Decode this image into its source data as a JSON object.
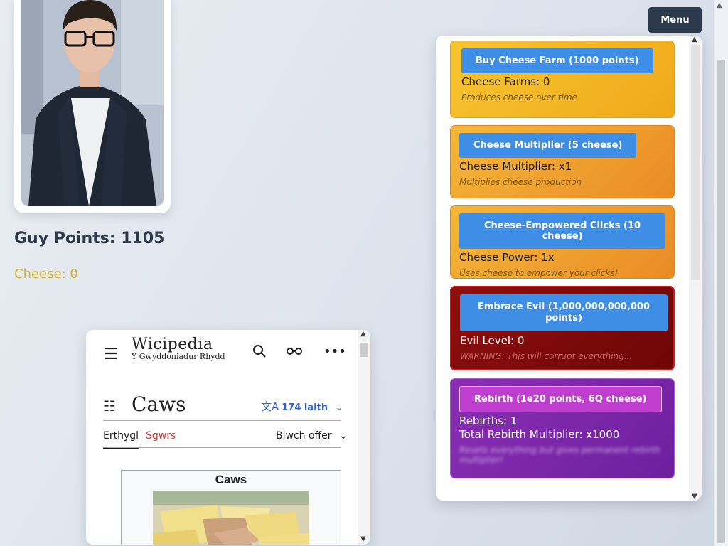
{
  "game": {
    "guy_points": "Guy Points: 1105",
    "cheese": "Cheese: 0",
    "menu_label": "Menu"
  },
  "upgrades": [
    {
      "button": "Buy Cheese Farm (1000 points)",
      "stats": [
        "Cheese Farms: 0"
      ],
      "description": "Produces cheese over time"
    },
    {
      "button": "Cheese Multiplier (5 cheese)",
      "stats": [
        "Cheese Multiplier: x1"
      ],
      "description": "Multiplies cheese production"
    },
    {
      "button": "Cheese-Empowered Clicks (10 cheese)",
      "stats": [
        "Cheese Power: 1x"
      ],
      "description": "Uses cheese to empower your clicks!"
    },
    {
      "button": "Embrace Evil (1,000,000,000,000 points)",
      "stats": [
        "Evil Level: 0"
      ],
      "description": "WARNING: This will corrupt everything..."
    },
    {
      "button": "Rebirth (1e20 points, 6Q cheese)",
      "stats": [
        "Rebirths: 1",
        "Total Rebirth Multiplier: x1000"
      ],
      "description": "Resets everything but gives permanent rebirth multiplier!"
    }
  ],
  "wiki": {
    "logo": "Wicipedia",
    "tagline": "Y Gwyddoniadur Rhydd",
    "title": "Caws",
    "languages": "174 iaith",
    "tabs": {
      "article": "Erthygl",
      "talk": "Sgwrs",
      "tools": "Blwch offer"
    },
    "infobox_title": "Caws"
  },
  "colors": {
    "accent_button": "#3e8ee6",
    "menu_bg": "#2c3a4c",
    "points_text": "#2e3a4a",
    "cheese_text": "#d4b025",
    "wiki_link": "#3366cc",
    "wiki_talk": "#dd3333"
  },
  "icons": [
    "hamburger-icon",
    "search-icon",
    "reading-glasses-icon",
    "more-options-icon",
    "contents-list-icon",
    "translate-icon",
    "chevron-down-icon"
  ]
}
